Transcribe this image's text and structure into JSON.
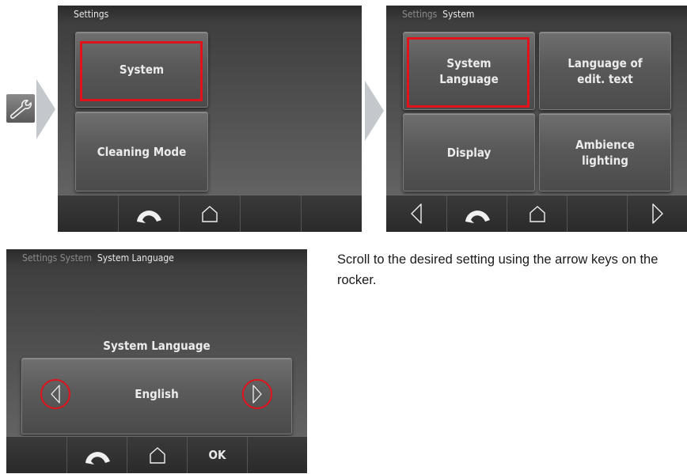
{
  "screen1": {
    "title": "Settings",
    "tiles": [
      "System",
      "Cleaning Mode"
    ]
  },
  "screen2": {
    "breadcrumb_dim": "Settings",
    "breadcrumb_current": "System",
    "tiles": [
      "System\nLanguage",
      "Language of\nedit. text",
      "Display",
      "Ambience\nlighting"
    ]
  },
  "screen3": {
    "breadcrumb_dim": "Settings  System",
    "breadcrumb_current": "System Language",
    "setting_label": "System Language",
    "value": "English",
    "ok_label": "OK"
  },
  "instruction": "Scroll to the desired setting using the arrow keys on the rocker.",
  "colors": {
    "highlight": "#e0121b",
    "panel_dark": "#2b2b2b",
    "tile_text": "#ececec"
  },
  "icons": [
    "wrench-icon",
    "arrow-chevron-icon",
    "back-icon",
    "home-icon",
    "left-arrow-icon",
    "right-arrow-icon"
  ]
}
